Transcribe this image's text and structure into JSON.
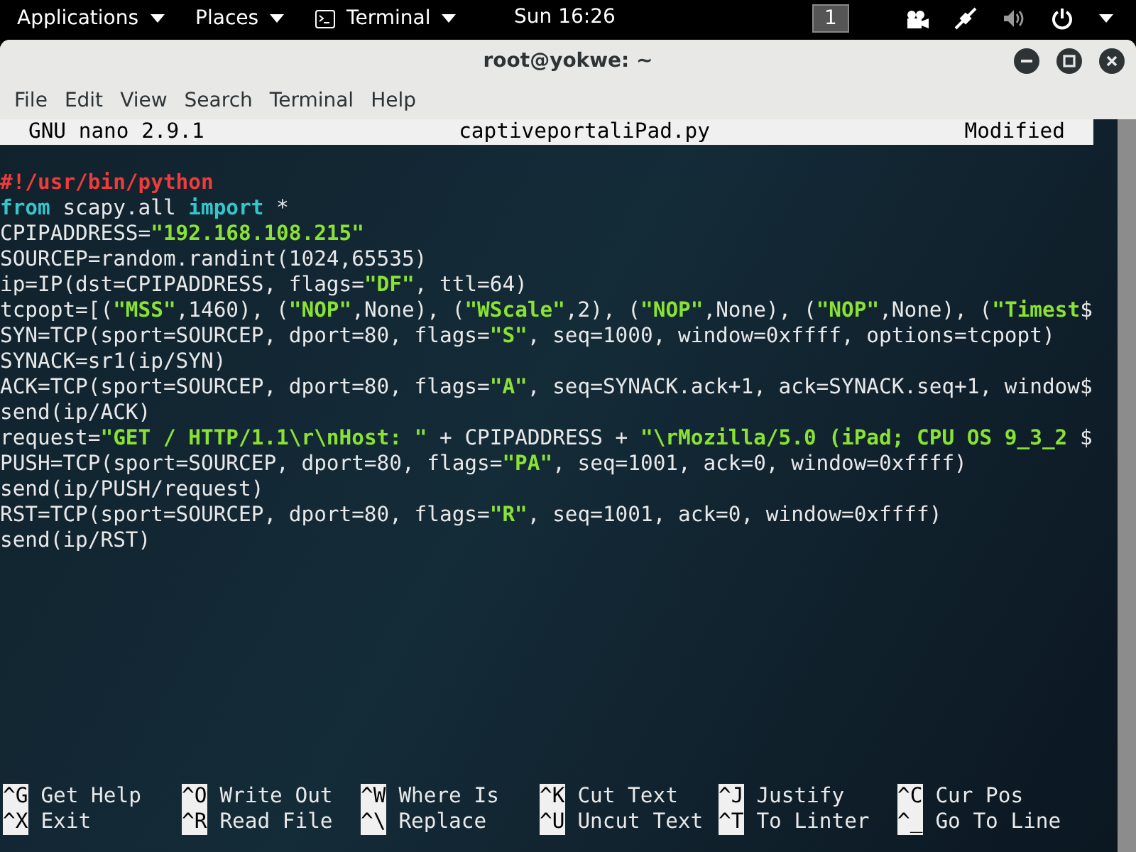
{
  "top_bar": {
    "menus": [
      {
        "label": "Applications",
        "kind": "plain"
      },
      {
        "label": "Places",
        "kind": "plain"
      },
      {
        "label": "Terminal",
        "kind": "app"
      }
    ],
    "clock": "Sun 16:26",
    "workspace": "1"
  },
  "window": {
    "title": "root@yokwe: ~",
    "menu": [
      "File",
      "Edit",
      "View",
      "Search",
      "Terminal",
      "Help"
    ]
  },
  "nano": {
    "version": "GNU nano 2.9.1",
    "filename": "captiveportaliPad.py",
    "status": "Modified",
    "lines": [
      [
        {
          "kind": "comment",
          "t": "#!/usr/bin/python"
        }
      ],
      [
        {
          "kind": "keyword",
          "t": "from"
        },
        {
          "kind": "text",
          "t": " scapy.all "
        },
        {
          "kind": "keyword",
          "t": "import"
        },
        {
          "kind": "text",
          "t": " *"
        }
      ],
      [
        {
          "kind": "text",
          "t": "CPIPADDRESS="
        },
        {
          "kind": "string",
          "t": "\"192.168.108.215\""
        }
      ],
      [
        {
          "kind": "text",
          "t": "SOURCEP=random.randint(1024,65535)"
        }
      ],
      [
        {
          "kind": "text",
          "t": "ip=IP(dst=CPIPADDRESS, flags="
        },
        {
          "kind": "string",
          "t": "\"DF\""
        },
        {
          "kind": "text",
          "t": ", ttl=64)"
        }
      ],
      [
        {
          "kind": "text",
          "t": "tcpopt=[("
        },
        {
          "kind": "string",
          "t": "\"MSS\""
        },
        {
          "kind": "text",
          "t": ",1460), ("
        },
        {
          "kind": "string",
          "t": "\"NOP\""
        },
        {
          "kind": "text",
          "t": ",None), ("
        },
        {
          "kind": "string",
          "t": "\"WScale\""
        },
        {
          "kind": "text",
          "t": ",2), ("
        },
        {
          "kind": "string",
          "t": "\"NOP\""
        },
        {
          "kind": "text",
          "t": ",None), ("
        },
        {
          "kind": "string",
          "t": "\"NOP\""
        },
        {
          "kind": "text",
          "t": ",None), ("
        },
        {
          "kind": "string",
          "t": "\"Timest"
        },
        {
          "kind": "text",
          "t": "$"
        }
      ],
      [
        {
          "kind": "text",
          "t": "SYN=TCP(sport=SOURCEP, dport=80, flags="
        },
        {
          "kind": "string",
          "t": "\"S\""
        },
        {
          "kind": "text",
          "t": ", seq=1000, window=0xffff, options=tcpopt)"
        }
      ],
      [
        {
          "kind": "text",
          "t": "SYNACK=sr1(ip/SYN)"
        }
      ],
      [
        {
          "kind": "text",
          "t": "ACK=TCP(sport=SOURCEP, dport=80, flags="
        },
        {
          "kind": "string",
          "t": "\"A\""
        },
        {
          "kind": "text",
          "t": ", seq=SYNACK.ack+1, ack=SYNACK.seq+1, window$"
        }
      ],
      [
        {
          "kind": "text",
          "t": "send(ip/ACK)"
        }
      ],
      [
        {
          "kind": "text",
          "t": "request="
        },
        {
          "kind": "string",
          "t": "\"GET / HTTP/1.1\\r\\nHost: \""
        },
        {
          "kind": "text",
          "t": " + CPIPADDRESS + "
        },
        {
          "kind": "string",
          "t": "\"\\rMozilla/5.0 (iPad; CPU OS 9_3_2 "
        },
        {
          "kind": "text",
          "t": "$"
        }
      ],
      [
        {
          "kind": "text",
          "t": "PUSH=TCP(sport=SOURCEP, dport=80, flags="
        },
        {
          "kind": "string",
          "t": "\"PA\""
        },
        {
          "kind": "text",
          "t": ", seq=1001, ack=0, window=0xffff)"
        }
      ],
      [
        {
          "kind": "text",
          "t": "send(ip/PUSH/request)"
        }
      ],
      [
        {
          "kind": "text",
          "t": "RST=TCP(sport=SOURCEP, dport=80, flags="
        },
        {
          "kind": "string",
          "t": "\"R\""
        },
        {
          "kind": "text",
          "t": ", seq=1001, ack=0, window=0xffff)"
        }
      ],
      [
        {
          "kind": "text",
          "t": "send(ip/RST)"
        }
      ]
    ],
    "shortcuts": [
      {
        "key": "^G",
        "label": "Get Help"
      },
      {
        "key": "^O",
        "label": "Write Out"
      },
      {
        "key": "^W",
        "label": "Where Is"
      },
      {
        "key": "^K",
        "label": "Cut Text"
      },
      {
        "key": "^J",
        "label": "Justify"
      },
      {
        "key": "^C",
        "label": "Cur Pos"
      },
      {
        "key": "^X",
        "label": "Exit"
      },
      {
        "key": "^R",
        "label": "Read File"
      },
      {
        "key": "^\\",
        "label": "Replace"
      },
      {
        "key": "^U",
        "label": "Uncut Text"
      },
      {
        "key": "^T",
        "label": "To Linter"
      },
      {
        "key": "^_",
        "label": "Go To Line"
      }
    ]
  }
}
